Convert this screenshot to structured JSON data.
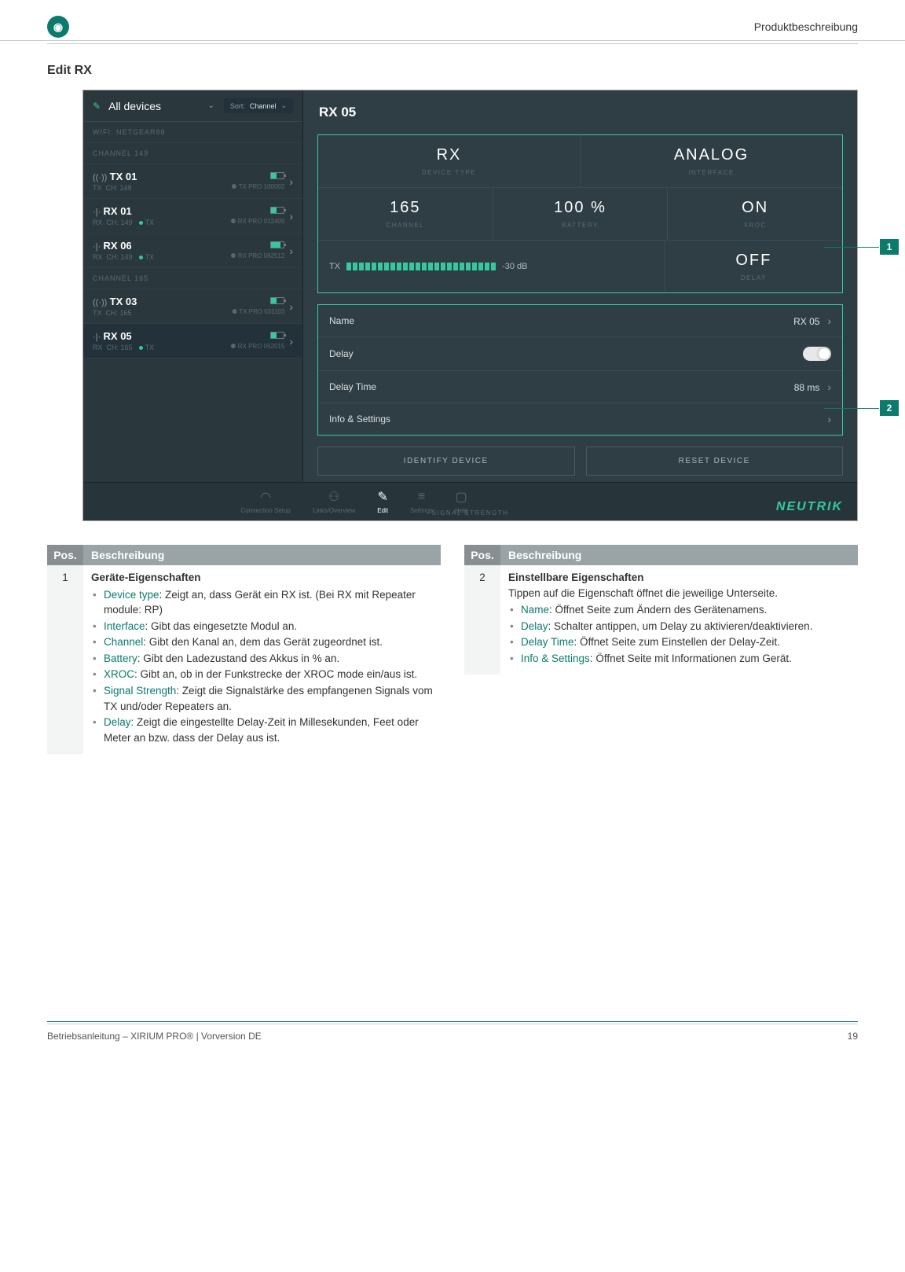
{
  "header": {
    "doc_section": "Produktbeschreibung"
  },
  "section_title": "Edit RX",
  "sidebar": {
    "all_devices": "All devices",
    "sort_label": "Sort:",
    "sort_value": "Channel",
    "wifi": "WIFI: NETGEAR88",
    "group1": "CHANNEL 149",
    "group2": "CHANNEL 165",
    "devices": [
      {
        "icon": "((·))",
        "name": "TX 01",
        "line2_a": "TX",
        "line2_b": "CH: 149",
        "model": "TX PRO 100002",
        "batt": 40
      },
      {
        "icon": "·|·",
        "name": "RX 01",
        "line2_a": "RX",
        "line2_b": "CH: 149",
        "link": "TX",
        "model": "RX PRO 012409",
        "batt": 40
      },
      {
        "icon": "·|·",
        "name": "RX 06",
        "line2_a": "RX",
        "line2_b": "CH: 149",
        "link": "TX",
        "model": "RX PRO 062512",
        "batt": 70
      },
      {
        "icon": "((·))",
        "name": "TX 03",
        "line2_a": "TX",
        "line2_b": "CH: 165",
        "model": "TX PRO 031103",
        "batt": 40
      },
      {
        "icon": "·|·",
        "name": "RX 05",
        "line2_a": "RX",
        "line2_b": "CH: 165",
        "link": "TX",
        "model": "RX PRO 052015",
        "batt": 40,
        "sel": true
      }
    ]
  },
  "main": {
    "title": "RX 05",
    "props": {
      "device_type": {
        "val": "RX",
        "lbl": "DEVICE TYPE"
      },
      "interface": {
        "val": "ANALOG",
        "lbl": "INTERFACE"
      },
      "channel": {
        "val": "165",
        "lbl": "CHANNEL"
      },
      "battery": {
        "val": "100 %",
        "lbl": "BATTERY"
      },
      "xroc": {
        "val": "ON",
        "lbl": "XROC"
      },
      "signal": {
        "prefix": "TX",
        "db": "-30 dB",
        "lbl": "SIGNAL STRENGTH"
      },
      "delay": {
        "val": "OFF",
        "lbl": "DELAY"
      }
    },
    "settings": {
      "name_lbl": "Name",
      "name_val": "RX 05",
      "delay_lbl": "Delay",
      "delaytime_lbl": "Delay Time",
      "delaytime_val": "88 ms",
      "info_lbl": "Info & Settings"
    },
    "buttons": {
      "identify": "IDENTIFY DEVICE",
      "reset": "RESET DEVICE"
    }
  },
  "nav": {
    "conn": "Connection Setup",
    "links": "Links/Overview",
    "edit": "Edit",
    "settings": "Settings",
    "help": "Help",
    "brand": "NEUTRIK"
  },
  "callouts": {
    "c1": "1",
    "c2": "2"
  },
  "table_header": {
    "pos": "Pos.",
    "desc": "Beschreibung"
  },
  "table1": {
    "pos": "1",
    "title": "Geräte-Eigenschaften",
    "items": [
      {
        "term": "Device type",
        "text": ": Zeigt an, dass Gerät ein RX ist. (Bei RX mit Repeater module: RP)"
      },
      {
        "term": "Interface",
        "text": ": Gibt das eingesetzte Modul an."
      },
      {
        "term": "Channel",
        "text": ": Gibt den Kanal an, dem das Gerät zugeordnet ist."
      },
      {
        "term": "Battery",
        "text": ": Gibt den Ladezustand des Akkus in % an."
      },
      {
        "term": "XROC",
        "text": ": Gibt an, ob in der Funkstrecke der XROC mode ein/aus ist."
      },
      {
        "term": "Signal Strength",
        "text": ": Zeigt die Signalstärke des empfangenen Signals vom TX und/oder Repeaters an."
      },
      {
        "term": "Delay:",
        "text": " Zeigt die eingestellte Delay-Zeit in Millesekunden, Feet oder Meter an bzw. dass der Delay aus ist."
      }
    ]
  },
  "table2": {
    "pos": "2",
    "title": "Einstellbare Eigenschaften",
    "intro": "Tippen auf die Eigenschaft öffnet die jeweilige Unterseite.",
    "items": [
      {
        "term": "Name",
        "text": ": Öffnet Seite zum Ändern des Gerätenamens."
      },
      {
        "term": "Delay",
        "text": ": Schalter antippen, um Delay zu aktivieren/deaktivieren."
      },
      {
        "term": "Delay Time",
        "text": ": Öffnet Seite zum Einstellen der Delay-Zeit."
      },
      {
        "term": "Info & Settings",
        "text": ": Öffnet Seite mit Informationen zum Gerät."
      }
    ]
  },
  "footer": {
    "left": "Betriebsanleitung – XIRIUM PRO® | Vorversion DE",
    "right": "19"
  }
}
